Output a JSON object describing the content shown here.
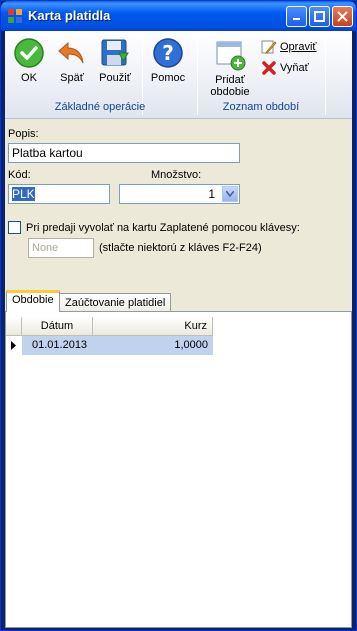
{
  "window": {
    "title": "Karta platidla",
    "minimize_label": "_",
    "maximize_label": "□",
    "close_label": "✕"
  },
  "toolbar": {
    "ok_label": "OK",
    "back_label": "Späť",
    "apply_label": "Použiť",
    "help_label": "Pomoc",
    "basic_ops_group": "Základné operácie",
    "add_period_label": "Pridať obdobie",
    "edit_label": "Opraviť",
    "remove_label": "Vyňať",
    "period_list_group": "Zoznam období"
  },
  "form": {
    "popis_label": "Popis:",
    "popis_value": "Platba kartou",
    "kod_label": "Kód:",
    "kod_value": "PLK",
    "mnozstvo_label": "Množstvo:",
    "mnozstvo_value": "1",
    "checkbox_label": "Pri predaji vyvolať na kartu Zaplatené pomocou klávesy:",
    "checkbox_checked": false,
    "hotkey_placeholder": "None",
    "hotkey_hint": "(stlačte niektorú z kláves F2-F24)"
  },
  "tabs": [
    {
      "label": "Obdobie",
      "active": true
    },
    {
      "label": "Zaúčtovanie platidiel",
      "active": false
    }
  ],
  "grid": {
    "columns": [
      "Dátum",
      "Kurz"
    ],
    "rows": [
      {
        "datum": "01.01.2013",
        "kurz": "1,0000"
      }
    ]
  },
  "colors": {
    "titlebar": "#0058ee",
    "selection": "#316ac5",
    "row_highlight": "#c1d2ee",
    "tab_accent": "#ffc83c"
  }
}
